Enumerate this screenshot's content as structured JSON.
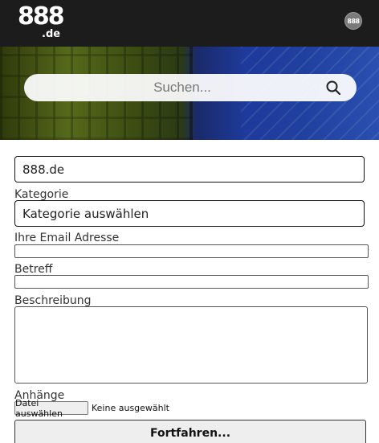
{
  "header": {
    "logo_text": "888",
    "logo_suffix": ".de",
    "avatar_text": "888"
  },
  "search": {
    "placeholder": "Suchen..."
  },
  "form": {
    "site_value": "888.de",
    "category_label": "Kategorie",
    "category_value": "Kategorie auswählen",
    "email_label": "Ihre Email Adresse",
    "subject_label": "Betreff",
    "description_label": "Beschreibung",
    "attachments_label": "Anhänge",
    "file_button_label": "Datei auswählen",
    "file_status": "Keine ausgewählt",
    "submit_label": "Fortfahren..."
  }
}
